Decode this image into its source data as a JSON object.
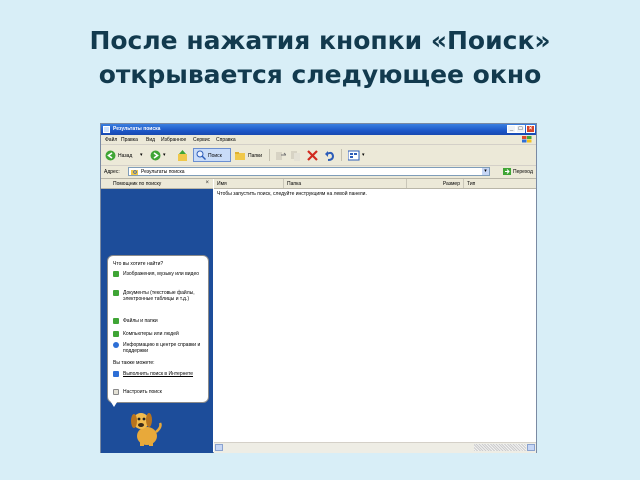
{
  "slide": {
    "title": "После нажатия кнопки «Поиск» открывается следующее окно"
  },
  "window": {
    "title": "Результаты поиска",
    "controls": {
      "minimize": "_",
      "maximize": "□",
      "close": "×"
    }
  },
  "menu": {
    "items": [
      "Файл",
      "Правка",
      "Вид",
      "Избранное",
      "Сервис",
      "Справка"
    ]
  },
  "toolbar": {
    "back_label": "Назад",
    "search_label": "Поиск",
    "folders_label": "Папки"
  },
  "address": {
    "label": "Адрес:",
    "value": "Результаты поиска",
    "go_label": "Переход"
  },
  "search_pane": {
    "title": "Помощник по поиску",
    "close": "×",
    "question": "Что вы хотите найти?",
    "options": [
      "Изображения, музыку или видео",
      "Документы (текстовые файлы, электронные таблицы и т.д.)",
      "Файлы и папки",
      "Компьютеры или людей",
      "Информацию в центре справки и поддержки"
    ],
    "also_label": "Вы также можете:",
    "links": [
      "Выполнить поиск в Интернете",
      "Настроить поиск"
    ]
  },
  "results": {
    "columns": [
      "Имя",
      "Папка",
      "Размер",
      "Тип"
    ],
    "message": "Чтобы запустить поиск, следуйте инструкциям на левой панели."
  },
  "colors": {
    "slide_bg": "#d8eef7",
    "title_text": "#123a4e",
    "titlebar": "#1c57c8",
    "pane_bg": "#1d4d9a"
  }
}
